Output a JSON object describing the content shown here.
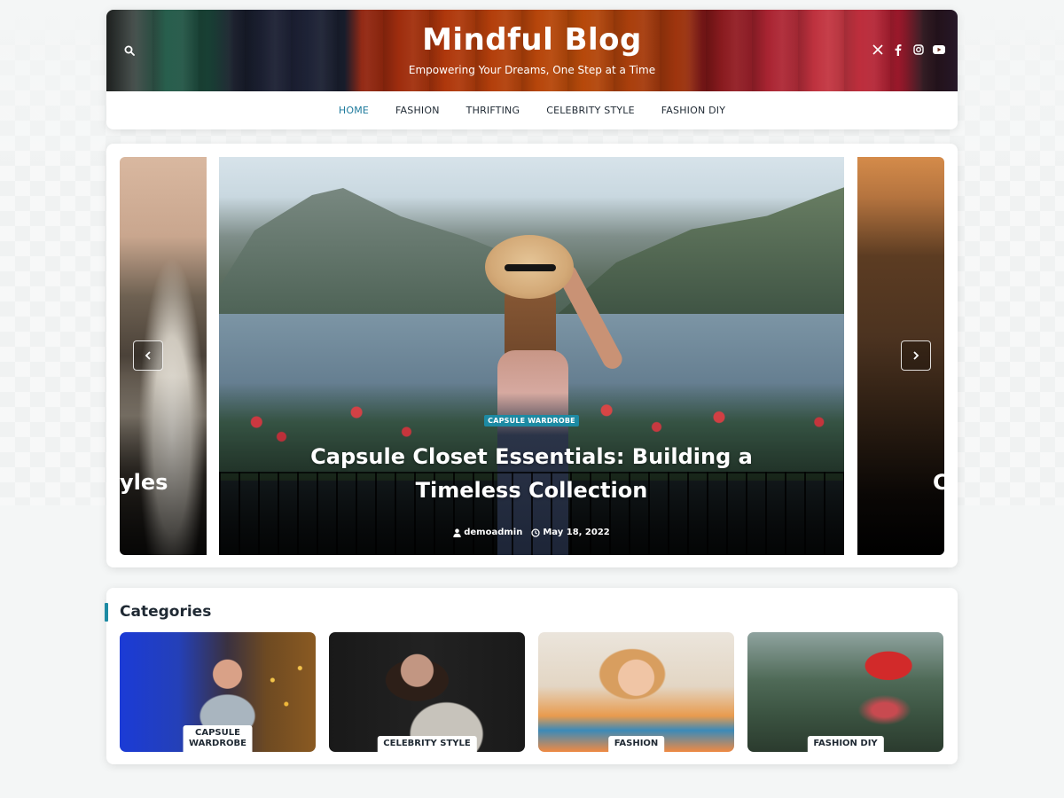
{
  "header": {
    "title": "Mindful Blog",
    "tagline": "Empowering Your Dreams, One Step at a Time",
    "search_icon": "search-icon",
    "social": [
      "x-twitter-icon",
      "facebook-icon",
      "instagram-icon",
      "youtube-icon"
    ]
  },
  "nav": {
    "items": [
      {
        "label": "HOME",
        "active": true
      },
      {
        "label": "FASHION"
      },
      {
        "label": "THRIFTING"
      },
      {
        "label": "CELEBRITY STYLE"
      },
      {
        "label": "FASHION DIY"
      }
    ]
  },
  "slider": {
    "prev_partial_title": "yles",
    "next_partial_title": "C",
    "current": {
      "category": "CAPSULE WARDROBE",
      "title": "Capsule Closet Essentials: Building a Timeless Collection",
      "author": "demoadmin",
      "date": "May 18, 2022"
    }
  },
  "categories": {
    "heading": "Categories",
    "items": [
      {
        "label": "CAPSULE\nWARDROBE"
      },
      {
        "label": "CELEBRITY STYLE"
      },
      {
        "label": "FASHION"
      },
      {
        "label": "FASHION DIY"
      }
    ]
  },
  "colors": {
    "accent": "#1d8aa3",
    "nav_active": "#1d7a9c",
    "text": "#1f2933"
  }
}
